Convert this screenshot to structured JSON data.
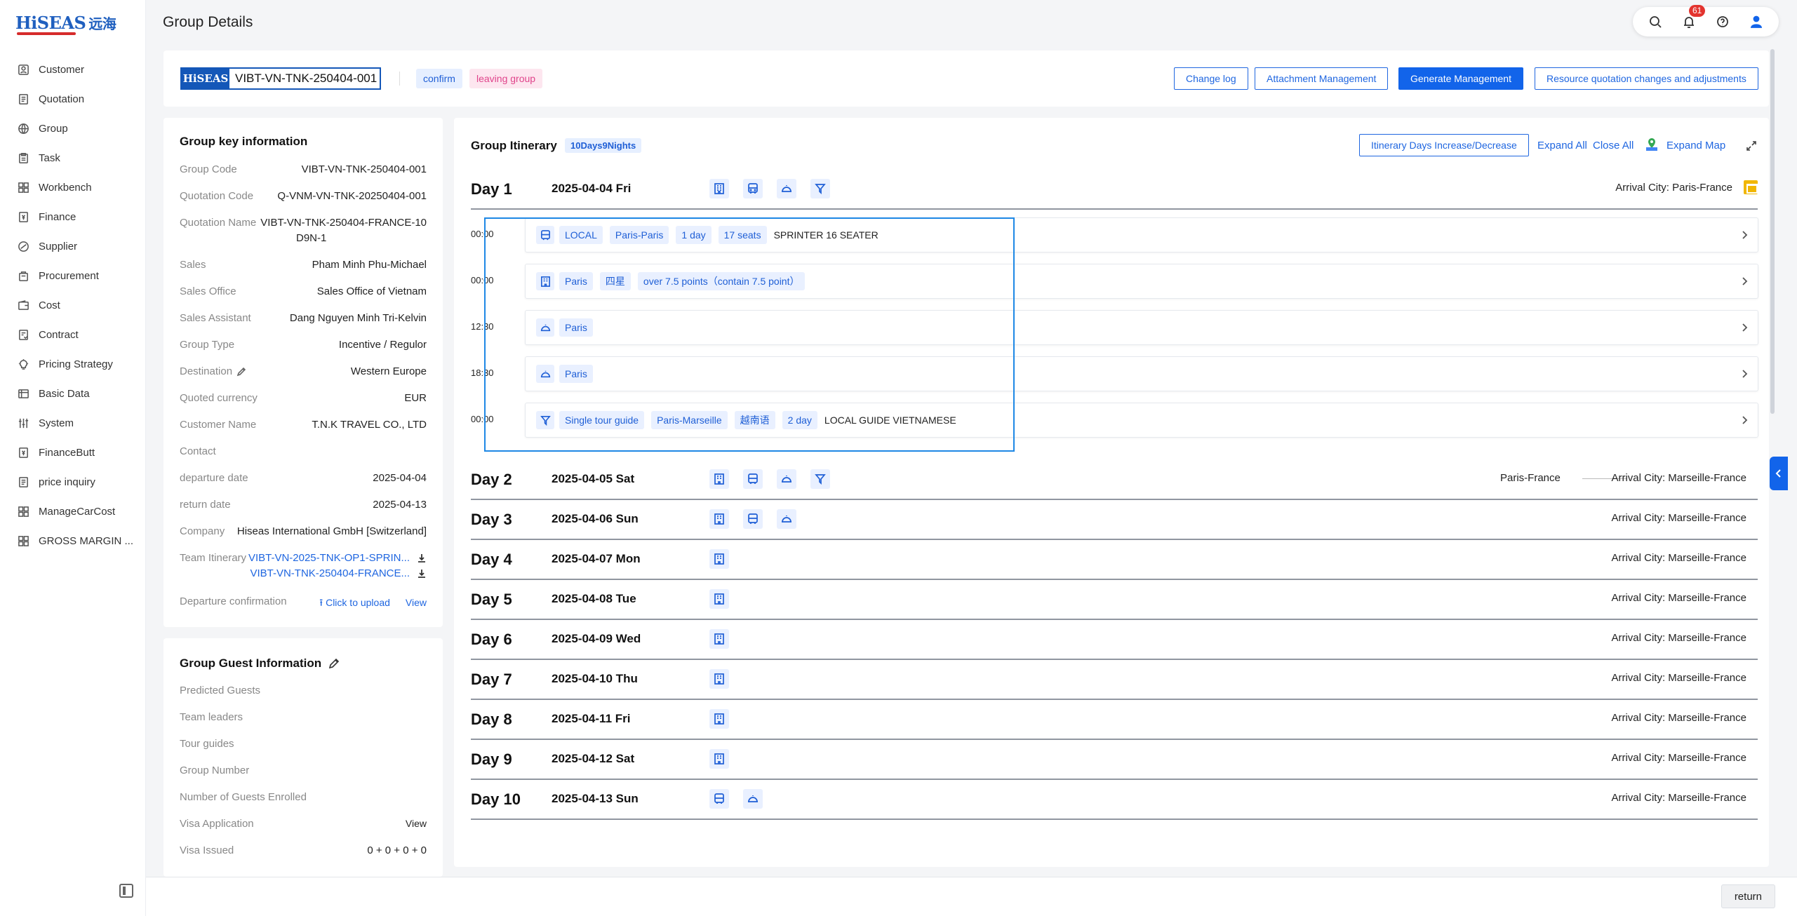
{
  "app": {
    "logo": "HiSEAS",
    "logo_cn": "远海",
    "page_title": "Group Details",
    "notification_count": "61"
  },
  "sidebar": {
    "items": [
      {
        "label": "Customer"
      },
      {
        "label": "Quotation"
      },
      {
        "label": "Group"
      },
      {
        "label": "Task"
      },
      {
        "label": "Workbench"
      },
      {
        "label": "Finance"
      },
      {
        "label": "Supplier"
      },
      {
        "label": "Procurement"
      },
      {
        "label": "Cost"
      },
      {
        "label": "Contract"
      },
      {
        "label": "Pricing Strategy"
      },
      {
        "label": "Basic Data"
      },
      {
        "label": "System"
      },
      {
        "label": "FinanceButt"
      },
      {
        "label": "price inquiry"
      },
      {
        "label": "ManageCarCost"
      },
      {
        "label": "GROSS MARGIN ..."
      }
    ]
  },
  "topbar": {
    "brand": "HiSEAS",
    "group_code": "VIBT-VN-TNK-250404-001",
    "status_confirm": "confirm",
    "status_leaving": "leaving group",
    "btn_change_log": "Change log",
    "btn_attachment": "Attachment Management",
    "btn_generate": "Generate Management",
    "btn_resource": "Resource quotation changes and adjustments"
  },
  "key_info": {
    "title": "Group key information",
    "group_code_k": "Group Code",
    "group_code_v": "VIBT-VN-TNK-250404-001",
    "quotation_code_k": "Quotation Code",
    "quotation_code_v": "Q-VNM-VN-TNK-20250404-001",
    "quotation_name_k": "Quotation Name",
    "quotation_name_v1": "VIBT-VN-TNK-250404-FRANCE-10",
    "quotation_name_v2": "D9N-1",
    "sales_k": "Sales",
    "sales_v": "Pham Minh Phu-Michael",
    "sales_office_k": "Sales Office",
    "sales_office_v": "Sales Office of Vietnam",
    "sales_assistant_k": "Sales Assistant",
    "sales_assistant_v": "Dang Nguyen Minh Tri-Kelvin",
    "group_type_k": "Group Type",
    "group_type_v": "Incentive / Regulor",
    "destination_k": "Destination",
    "destination_v": "Western Europe",
    "currency_k": "Quoted currency",
    "currency_v": "EUR",
    "customer_k": "Customer Name",
    "customer_v": "T.N.K TRAVEL CO., LTD",
    "contact_k": "Contact",
    "departure_k": "departure date",
    "departure_v": "2025-04-04",
    "return_k": "return date",
    "return_v": "2025-04-13",
    "company_k": "Company",
    "company_v": "Hiseas International GmbH [Switzerland]",
    "team_itin_k": "Team Itinerary",
    "team_itin_v1": "VIBT-VN-2025-TNK-OP1-SPRIN...",
    "team_itin_v2": "VIBT-VN-TNK-250404-FRANCE...",
    "dep_confirm_k": "Departure confirmation",
    "upload": "Click to upload",
    "view": "View"
  },
  "guest_info": {
    "title": "Group Guest Information",
    "predicted": "Predicted Guests",
    "team_leaders": "Team leaders",
    "tour_guides": "Tour guides",
    "group_number": "Group Number",
    "enrolled": "Number of Guests Enrolled",
    "visa_app": "Visa Application",
    "visa_app_v": "View",
    "visa_issued": "Visa Issued",
    "visa_issued_v": "0 + 0 + 0 + 0"
  },
  "itinerary": {
    "title": "Group Itinerary",
    "days_badge": "10Days9Nights",
    "btn_days": "Itinerary Days Increase/Decrease",
    "expand_all": "Expand All",
    "close_all": "Close All",
    "expand_map": "Expand Map",
    "arrival_prefix": "Arrival City:",
    "days": [
      {
        "n": "Day 1",
        "date": "2025-04-04 Fri",
        "arrival": "Paris-France",
        "from": ""
      },
      {
        "n": "Day 2",
        "date": "2025-04-05 Sat",
        "arrival": "Marseille-France",
        "from": "Paris-France"
      },
      {
        "n": "Day 3",
        "date": "2025-04-06 Sun",
        "arrival": "Marseille-France",
        "from": ""
      },
      {
        "n": "Day 4",
        "date": "2025-04-07 Mon",
        "arrival": "Marseille-France",
        "from": ""
      },
      {
        "n": "Day 5",
        "date": "2025-04-08 Tue",
        "arrival": "Marseille-France",
        "from": ""
      },
      {
        "n": "Day 6",
        "date": "2025-04-09 Wed",
        "arrival": "Marseille-France",
        "from": ""
      },
      {
        "n": "Day 7",
        "date": "2025-04-10 Thu",
        "arrival": "Marseille-France",
        "from": ""
      },
      {
        "n": "Day 8",
        "date": "2025-04-11 Fri",
        "arrival": "Marseille-France",
        "from": ""
      },
      {
        "n": "Day 9",
        "date": "2025-04-12 Sat",
        "arrival": "Marseille-France",
        "from": ""
      },
      {
        "n": "Day 10",
        "date": "2025-04-13 Sun",
        "arrival": "Marseille-France",
        "from": ""
      }
    ],
    "day1_services": [
      {
        "time": "00:00",
        "chips": [
          "LOCAL",
          "Paris-Paris",
          "1 day",
          "17 seats"
        ],
        "text": "SPRINTER 16 SEATER"
      },
      {
        "time": "00:00",
        "chips": [
          "Paris",
          "四星",
          "over 7.5 points（contain 7.5 point）"
        ],
        "text": ""
      },
      {
        "time": "12:30",
        "chips": [
          "Paris"
        ],
        "text": ""
      },
      {
        "time": "18:30",
        "chips": [
          "Paris"
        ],
        "text": ""
      },
      {
        "time": "00:00",
        "chips": [
          "Single tour guide",
          "Paris-Marseille",
          "越南语",
          "2 day"
        ],
        "text": "LOCAL GUIDE VIETNAMESE"
      }
    ]
  },
  "footer": {
    "return": "return"
  }
}
